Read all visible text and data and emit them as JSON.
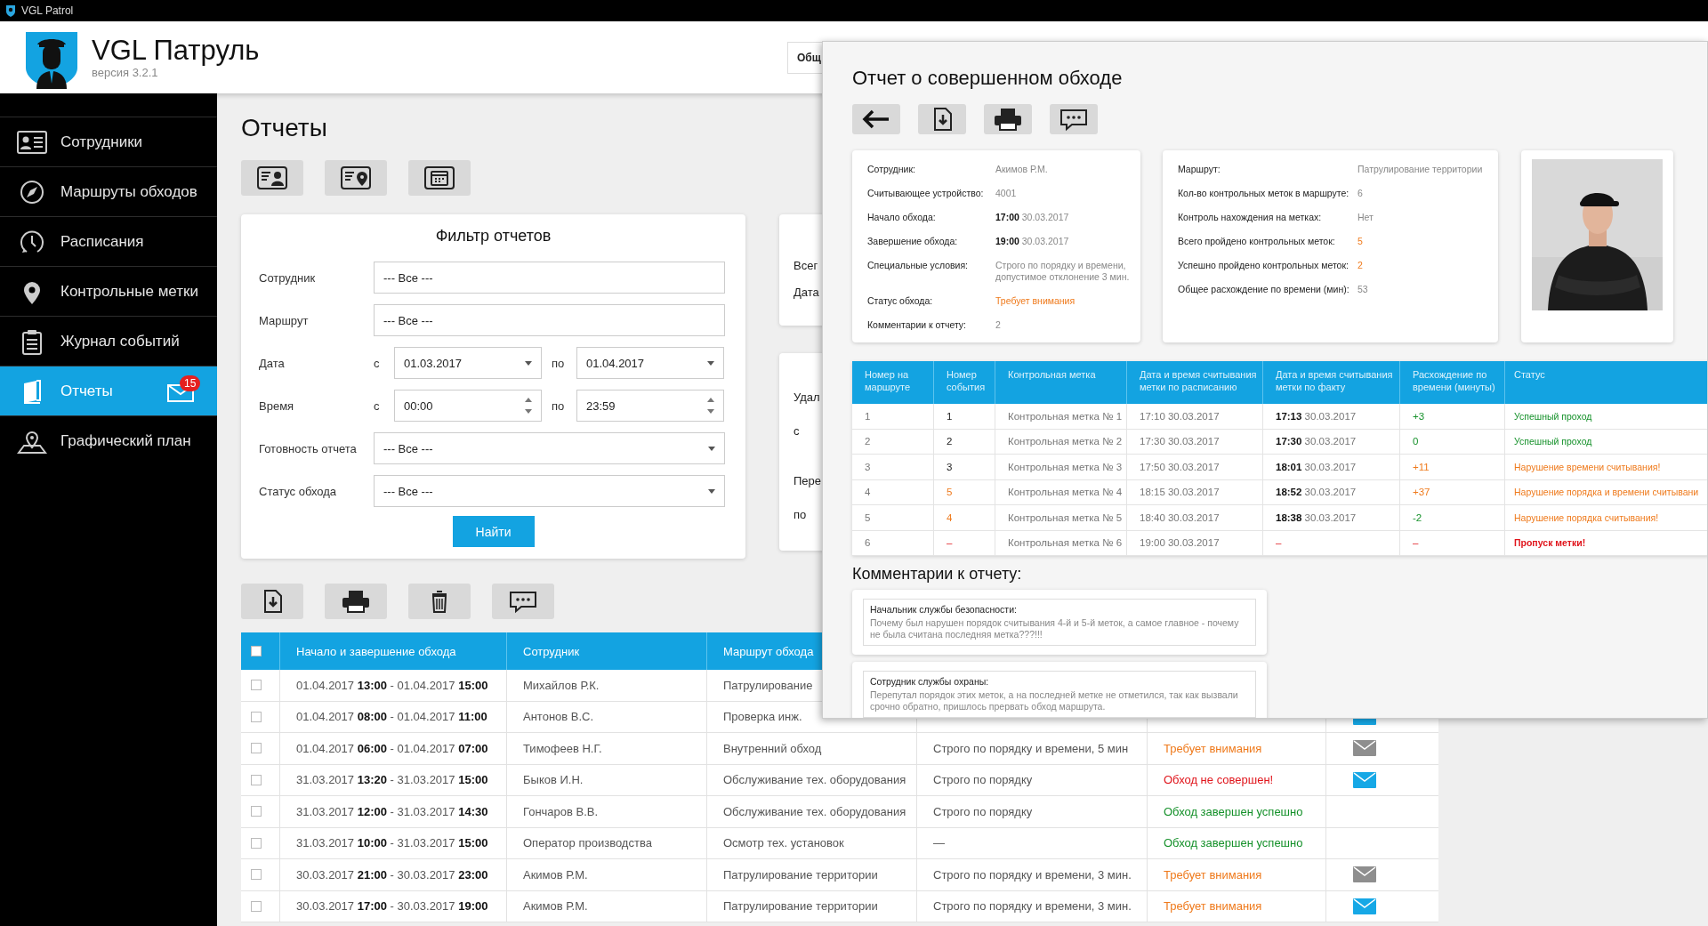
{
  "window": {
    "title": "VGL Patrol"
  },
  "app": {
    "name": "VGL Патруль",
    "version": "версия 3.2.1"
  },
  "header_button": {
    "label": "Общ"
  },
  "sidebar": {
    "items": [
      {
        "label": "Сотрудники",
        "selected": false
      },
      {
        "label": "Маршруты обходов",
        "selected": false
      },
      {
        "label": "Расписания",
        "selected": false
      },
      {
        "label": "Контрольные метки",
        "selected": false
      },
      {
        "label": "Журнал событий",
        "selected": false
      },
      {
        "label": "Отчеты",
        "selected": true,
        "badge": "15"
      },
      {
        "label": "Графический план",
        "selected": false
      }
    ]
  },
  "page": {
    "title": "Отчеты"
  },
  "filter": {
    "title": "Фильтр отчетов",
    "button": "Найти",
    "fields": [
      {
        "kind": "plain",
        "label": "Сотрудник",
        "value": "--- Все ---"
      },
      {
        "kind": "plain",
        "label": "Маршрут",
        "value": "--- Все ---"
      },
      {
        "kind": "date_range",
        "label": "Дата",
        "from_prefix": "с",
        "from": "01.03.2017",
        "to_prefix": "по",
        "to": "01.04.2017"
      },
      {
        "kind": "time_range",
        "label": "Время",
        "from_prefix": "с",
        "from": "00:00",
        "to_prefix": "по",
        "to": "23:59"
      },
      {
        "kind": "select",
        "label": "Готовность отчета",
        "value": "--- Все ---"
      },
      {
        "kind": "select",
        "label": "Статус обхода",
        "value": "--- Все ---"
      }
    ]
  },
  "side_cards": [
    {
      "texts": [
        "Всег",
        "Дата"
      ]
    },
    {
      "texts": [
        "Удал",
        "с",
        "Пере",
        "по"
      ]
    }
  ],
  "reports_table": {
    "all_checked": false,
    "columns": [
      "Начало и завершение обхода",
      "Сотрудник",
      "Маршрут обхода"
    ],
    "rows": [
      {
        "checked": false,
        "period": "01.04.2017 **13:00** - 01.04.2017 **15:00**",
        "employee": "Михайлов Р.К.",
        "route": "Патрулирование"
      },
      {
        "checked": false,
        "period": "01.04.2017 **08:00** - 01.04.2017 **11:00**",
        "employee": "Антонов В.С.",
        "route": "Проверка инж.",
        "mail_unread": true
      },
      {
        "checked": false,
        "period": "01.04.2017 **06:00** - 01.04.2017 **07:00**",
        "employee": "Тимофеев Н.Г.",
        "route": "Внутренний обход",
        "conditions": "Строго по порядку и времени, 5 мин",
        "status": {
          "text": "Требует внимания",
          "kind": "warning"
        },
        "mail_unread": false
      },
      {
        "checked": false,
        "period": "31.03.2017 **13:20** - 31.03.2017 **15:00**",
        "employee": "Быков И.Н.",
        "route": "Обслуживание тех. оборудования",
        "conditions": "Строго по порядку",
        "status": {
          "text": "Обход не совершен!",
          "kind": "error"
        },
        "mail_unread": true
      },
      {
        "checked": false,
        "period": "31.03.2017 **12:00** - 31.03.2017 **14:30**",
        "employee": "Гончаров В.В.",
        "route": "Обслуживание тех. оборудования",
        "conditions": "Строго по порядку",
        "status": {
          "text": "Обход завершен успешно",
          "kind": "ok"
        }
      },
      {
        "checked": false,
        "period": "31.03.2017 **10:00** - 31.03.2017 **15:00**",
        "employee": "Оператор производства",
        "route": "Осмотр тех. установок",
        "conditions": "—",
        "status": {
          "text": "Обход завершен успешно",
          "kind": "ok"
        }
      },
      {
        "checked": false,
        "period": "30.03.2017 **21:00** - 30.03.2017 **23:00**",
        "employee": "Акимов Р.М.",
        "route": "Патрулирование территории",
        "conditions": "Строго по порядку и времени, 3 мин.",
        "status": {
          "text": "Требует внимания",
          "kind": "warning"
        },
        "mail_unread": false
      },
      {
        "checked": false,
        "period": "30.03.2017 **17:00** - 30.03.2017 **19:00**",
        "employee": "Акимов Р.М.",
        "route": "Патрулирование территории",
        "conditions": "Строго по порядку и времени, 3 мин.",
        "status": {
          "text": "Требует внимания",
          "kind": "warning"
        },
        "mail_unread": true
      }
    ]
  },
  "report": {
    "title": "Отчет о совершенном обходе",
    "details": [
      {
        "label": "Сотрудник:",
        "value": "Акимов Р.М.",
        "kind": "plain"
      },
      {
        "label": "Считывающее устройство:",
        "value": "4001",
        "kind": "plain"
      },
      {
        "label": "Начало обхода:",
        "value": "**17:00** 30.03.2017",
        "kind": "plain"
      },
      {
        "label": "Завершение обхода:",
        "value": "**19:00** 30.03.2017",
        "kind": "plain"
      },
      {
        "label": "Специальные условия:",
        "value": "Строго по порядку и времени, допустимое отклонение 3 мин.",
        "kind": "plain"
      },
      {
        "label": "Статус обхода:",
        "value": "Требует внимания",
        "kind": "warning"
      },
      {
        "label": "Комментарии к отчету:",
        "value": "2",
        "kind": "plain"
      }
    ],
    "route_details": [
      {
        "label": "Маршрут:",
        "value": "Патрулирование территории",
        "kind": "plain"
      },
      {
        "label": "Кол-во контрольных меток в маршруте:",
        "value": "6",
        "kind": "plain"
      },
      {
        "label": "Контроль нахождения на метках:",
        "value": "Нет",
        "kind": "plain"
      },
      {
        "label": "Всего пройдено контрольных меток:",
        "value": "5",
        "kind": "warning"
      },
      {
        "label": "Успешно пройдено контрольных меток:",
        "value": "2",
        "kind": "warning"
      },
      {
        "label": "Общее расхождение по времени (мин):",
        "value": "53",
        "kind": "plain"
      }
    ],
    "marks_table": {
      "columns": [
        "Номер на маршруте",
        "Номер события",
        "Контрольная метка",
        "Дата и время считывания метки по расписанию",
        "Дата и время считывания метки по факту",
        "Расхождение по времени (минуты)",
        "Статус"
      ],
      "rows": [
        {
          "route_no": "1",
          "event": {
            "text": "1",
            "kind": "plain"
          },
          "mark": "Контрольная метка № 1",
          "scheduled": "17:10 30.03.2017",
          "actual": {
            "text": "**17:13** 30.03.2017",
            "kind": "plain"
          },
          "diff": {
            "text": "+3",
            "kind": "ok"
          },
          "status": {
            "text": "Успешный проход",
            "kind": "ok"
          }
        },
        {
          "route_no": "2",
          "event": {
            "text": "2",
            "kind": "plain"
          },
          "mark": "Контрольная метка № 2",
          "scheduled": "17:30 30.03.2017",
          "actual": {
            "text": "**17:30** 30.03.2017",
            "kind": "plain"
          },
          "diff": {
            "text": "0",
            "kind": "ok"
          },
          "status": {
            "text": "Успешный проход",
            "kind": "ok"
          }
        },
        {
          "route_no": "3",
          "event": {
            "text": "3",
            "kind": "plain"
          },
          "mark": "Контрольная метка № 3",
          "scheduled": "17:50 30.03.2017",
          "actual": {
            "text": "**18:01** 30.03.2017",
            "kind": "plain"
          },
          "diff": {
            "text": "+11",
            "kind": "warning"
          },
          "status": {
            "text": "Нарушение времени считывания!",
            "kind": "warning"
          }
        },
        {
          "route_no": "4",
          "event": {
            "text": "5",
            "kind": "warning"
          },
          "mark": "Контрольная метка № 4",
          "scheduled": "18:15 30.03.2017",
          "actual": {
            "text": "**18:52** 30.03.2017",
            "kind": "plain"
          },
          "diff": {
            "text": "+37",
            "kind": "warning"
          },
          "status": {
            "text": "Нарушение порядка и времени считывани",
            "kind": "warning"
          }
        },
        {
          "route_no": "5",
          "event": {
            "text": "4",
            "kind": "warning"
          },
          "mark": "Контрольная метка № 5",
          "scheduled": "18:40 30.03.2017",
          "actual": {
            "text": "**18:38** 30.03.2017",
            "kind": "plain"
          },
          "diff": {
            "text": "-2",
            "kind": "ok"
          },
          "status": {
            "text": "Нарушение порядка считывания!",
            "kind": "warning"
          }
        },
        {
          "route_no": "6",
          "event": {
            "text": "–",
            "kind": "error"
          },
          "mark": "Контрольная метка № 6",
          "scheduled": "19:00 30.03.2017",
          "actual": {
            "text": "–",
            "kind": "error"
          },
          "diff": {
            "text": "–",
            "kind": "error"
          },
          "status": {
            "text": "Пропуск метки!",
            "kind": "error"
          }
        }
      ]
    },
    "comments_title": "Комментарии к отчету:",
    "comments": [
      {
        "author": "Начальник службы безопасности:",
        "text": "Почему был нарушен порядок считывания 4-й и 5-й меток, а самое главное - почему не была считана последняя метка???!!!"
      },
      {
        "author": "Сотрудник службы охраны:",
        "text": "Перепутал порядок этих меток, а на последней метке не отметился, так как вызвали срочно обратно, пришлось прервать обход маршрута."
      }
    ]
  }
}
